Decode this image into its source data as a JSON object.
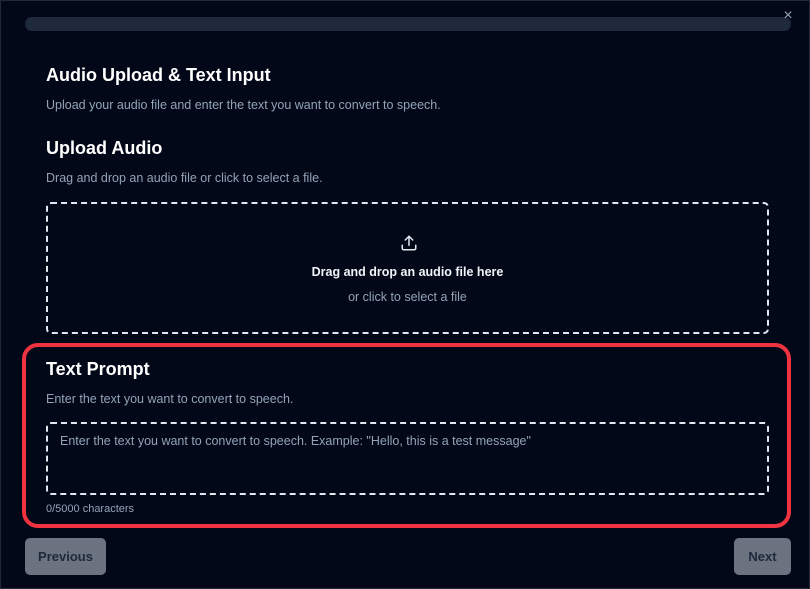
{
  "dialog": {
    "close_icon": "×",
    "title": "Audio Upload & Text Input",
    "subtitle": "Upload your audio file and enter the text you want to convert to speech."
  },
  "upload": {
    "heading": "Upload Audio",
    "description": "Drag and drop an audio file or click to select a file.",
    "icon": "upload-icon",
    "dropzone_title": "Drag and drop an audio file here",
    "dropzone_subtitle": "or click to select a file"
  },
  "text_prompt": {
    "heading": "Text Prompt",
    "description": "Enter the text you want to convert to speech.",
    "value": "",
    "placeholder": "Enter the text you want to convert to speech. Example: \"Hello, this is a test message\"",
    "counter": "0/5000 characters"
  },
  "footer": {
    "previous_label": "Previous",
    "next_label": "Next"
  },
  "colors": {
    "background": "#020817",
    "highlight": "#ef3340",
    "button_disabled": "#6b7280",
    "muted_text": "#94a3b8"
  }
}
